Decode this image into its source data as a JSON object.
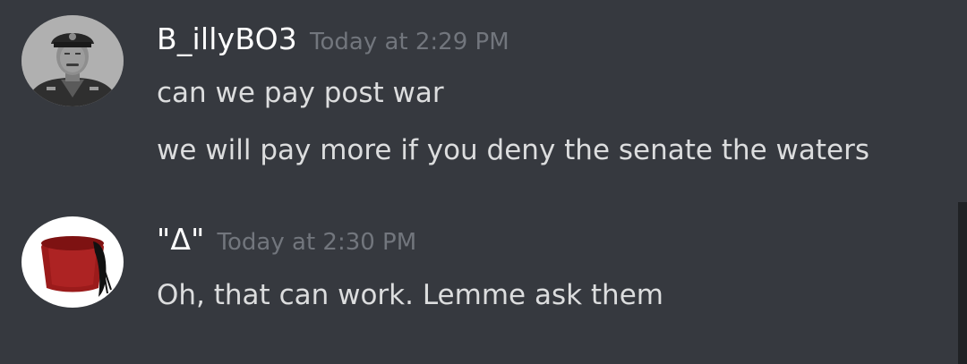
{
  "messages": [
    {
      "username": "B_illyBO3",
      "timestamp": "Today at 2:29 PM",
      "lines": [
        "can we pay post war",
        "we will pay more if you deny the senate the waters"
      ]
    },
    {
      "username": "\"Δ\"",
      "timestamp": "Today at 2:30 PM",
      "lines": [
        "Oh, that can work.  Lemme ask them"
      ]
    }
  ],
  "colors": {
    "background": "#36393f",
    "username": "#ffffff",
    "timestamp": "#72767d",
    "message_text": "#dcddde",
    "scrollbar": "#202225"
  },
  "icons": {
    "avatar_1": "officer-portrait-avatar-icon",
    "avatar_2": "red-fez-avatar-icon"
  }
}
